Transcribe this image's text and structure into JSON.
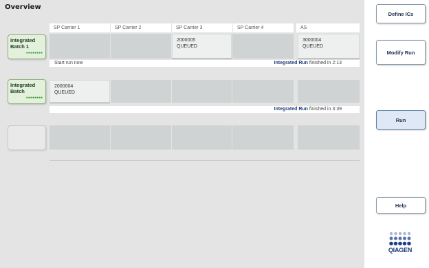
{
  "page": {
    "title": "Overview"
  },
  "columns": [
    "SP Carrier 1",
    "SP Carrier 2",
    "SP Carrier 3",
    "SP Carrier 4",
    "AS"
  ],
  "batches": [
    {
      "label_line1": "Integrated",
      "label_line2": "Batch 1",
      "cells": [
        {
          "line1": "",
          "line2": ""
        },
        {
          "line1": "",
          "line2": ""
        },
        {
          "line1": "2000005",
          "line2": "QUEUED"
        },
        {
          "line1": "",
          "line2": ""
        },
        {
          "line1": "3000004",
          "line2": "QUEUED"
        }
      ],
      "status_left": "Start run now",
      "status_run": "Integrated Run",
      "status_right": "finished in 2:13"
    },
    {
      "label_line1": "Integrated",
      "label_line2": "Batch",
      "cells": [
        {
          "line1": "2000004",
          "line2": "QUEUED"
        },
        {
          "line1": "",
          "line2": ""
        },
        {
          "line1": "",
          "line2": ""
        },
        {
          "line1": "",
          "line2": ""
        },
        {
          "line1": "",
          "line2": ""
        }
      ],
      "status_left": "",
      "status_run": "Integrated Run",
      "status_right": "finished in 3:39"
    }
  ],
  "sidebar": {
    "define_ics": "Define ICs",
    "modify_run": "Modify Run",
    "run": "Run",
    "help": "Help"
  },
  "logo": {
    "text": "QIAGEN"
  },
  "colors": {
    "batch_green": "#e3f1dc",
    "run_blue": "#1f3f7a",
    "cell_empty": "#cfd3d3"
  }
}
